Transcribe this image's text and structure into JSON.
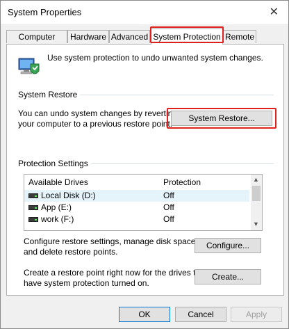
{
  "window": {
    "title": "System Properties",
    "close_glyph": "✕"
  },
  "tabs": [
    {
      "label": "Computer Name",
      "active": false
    },
    {
      "label": "Hardware",
      "active": false
    },
    {
      "label": "Advanced",
      "active": false
    },
    {
      "label": "System Protection",
      "active": true
    },
    {
      "label": "Remote",
      "active": false
    }
  ],
  "intro": {
    "icon": "computer-shield-icon",
    "text": "Use system protection to undo unwanted system changes."
  },
  "system_restore": {
    "heading": "System Restore",
    "description_line1": "You can undo system changes by reverting",
    "description_line2": "your computer to a previous restore point.",
    "button_label": "System Restore..."
  },
  "protection": {
    "heading": "Protection Settings",
    "columns": [
      "Available Drives",
      "Protection"
    ],
    "drives": [
      {
        "name": "Local Disk (D:)",
        "protection": "Off"
      },
      {
        "name": "App (E:)",
        "protection": "Off"
      },
      {
        "name": "work (F:)",
        "protection": "Off"
      }
    ],
    "configure_text_line1": "Configure restore settings, manage disk space,",
    "configure_text_line2": "and delete restore points.",
    "configure_label": "Configure...",
    "create_text_line1": "Create a restore point right now for the drives that",
    "create_text_line2": "have system protection turned on.",
    "create_label": "Create..."
  },
  "footer": {
    "ok": "OK",
    "cancel": "Cancel",
    "apply": "Apply"
  },
  "colors": {
    "highlight": "#e0201c",
    "accent": "#0078d7"
  }
}
